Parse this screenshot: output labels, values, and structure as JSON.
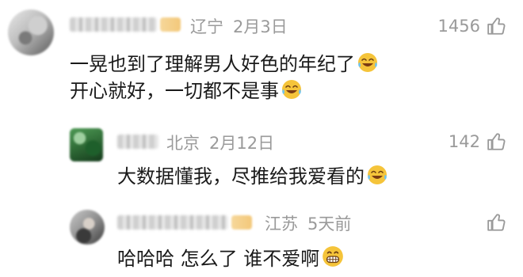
{
  "comments": [
    {
      "location": "辽宁",
      "date": "2月3日",
      "likes": "1456",
      "lines": [
        "一晃也到了理解男人好色的年纪了",
        "开心就好，一切都不是事"
      ],
      "line_emojis": [
        "laughing-tears",
        "laughing-tears"
      ]
    },
    {
      "location": "北京",
      "date": "2月12日",
      "likes": "142",
      "lines": [
        "大数据懂我，尽推给我爱看的"
      ],
      "line_emojis": [
        "laughing-tears"
      ]
    },
    {
      "location": "江苏",
      "date": "5天前",
      "likes": "",
      "lines": [
        "哈哈哈 怎么了 谁不爱啊"
      ],
      "line_emojis": [
        "grinning"
      ]
    }
  ],
  "colors": {
    "meta_text": "#9a9a9a",
    "body_text": "#1a1a1a",
    "emoji_yellow": "#f5c43a"
  }
}
